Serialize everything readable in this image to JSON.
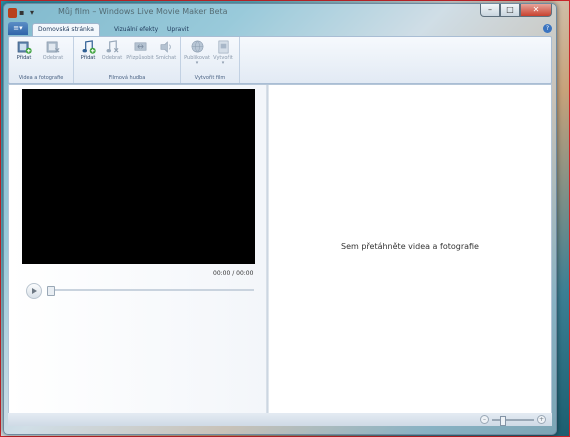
{
  "window": {
    "title": "Můj film – Windows Live Movie Maker Beta"
  },
  "titlebar_buttons": {
    "minimize": "–",
    "maximize": "□",
    "close": "✕"
  },
  "tabs": [
    {
      "label": "Domovská stránka",
      "active": true
    },
    {
      "label": "Vizuální efekty",
      "active": false
    },
    {
      "label": "Upravit",
      "active": false
    }
  ],
  "ribbon": {
    "groups": [
      {
        "label": "Videa a fotografie",
        "buttons": [
          {
            "label": "Přidat",
            "icon": "add-video-icon",
            "enabled": true
          },
          {
            "label": "Odebrat",
            "icon": "remove-video-icon",
            "enabled": false
          }
        ]
      },
      {
        "label": "Filmová hudba",
        "buttons": [
          {
            "label": "Přidat",
            "icon": "add-music-icon",
            "enabled": true
          },
          {
            "label": "Odebrat",
            "icon": "remove-music-icon",
            "enabled": false
          },
          {
            "label": "Přizpůsobit",
            "icon": "fit-icon",
            "enabled": false
          },
          {
            "label": "Smíchat",
            "icon": "mix-icon",
            "enabled": false
          }
        ]
      },
      {
        "label": "Vytvořit film",
        "buttons": [
          {
            "label": "Publikovat",
            "icon": "publish-globe-icon",
            "enabled": false
          },
          {
            "label": "Vytvořit",
            "icon": "create-film-icon",
            "enabled": false
          }
        ]
      }
    ]
  },
  "preview": {
    "time": "00:00 / 00:00"
  },
  "storyboard": {
    "placeholder": "Sem přetáhněte videa a fotografie"
  },
  "colors": {
    "accent": "#2f64a8",
    "preview_bg": "#000000"
  }
}
